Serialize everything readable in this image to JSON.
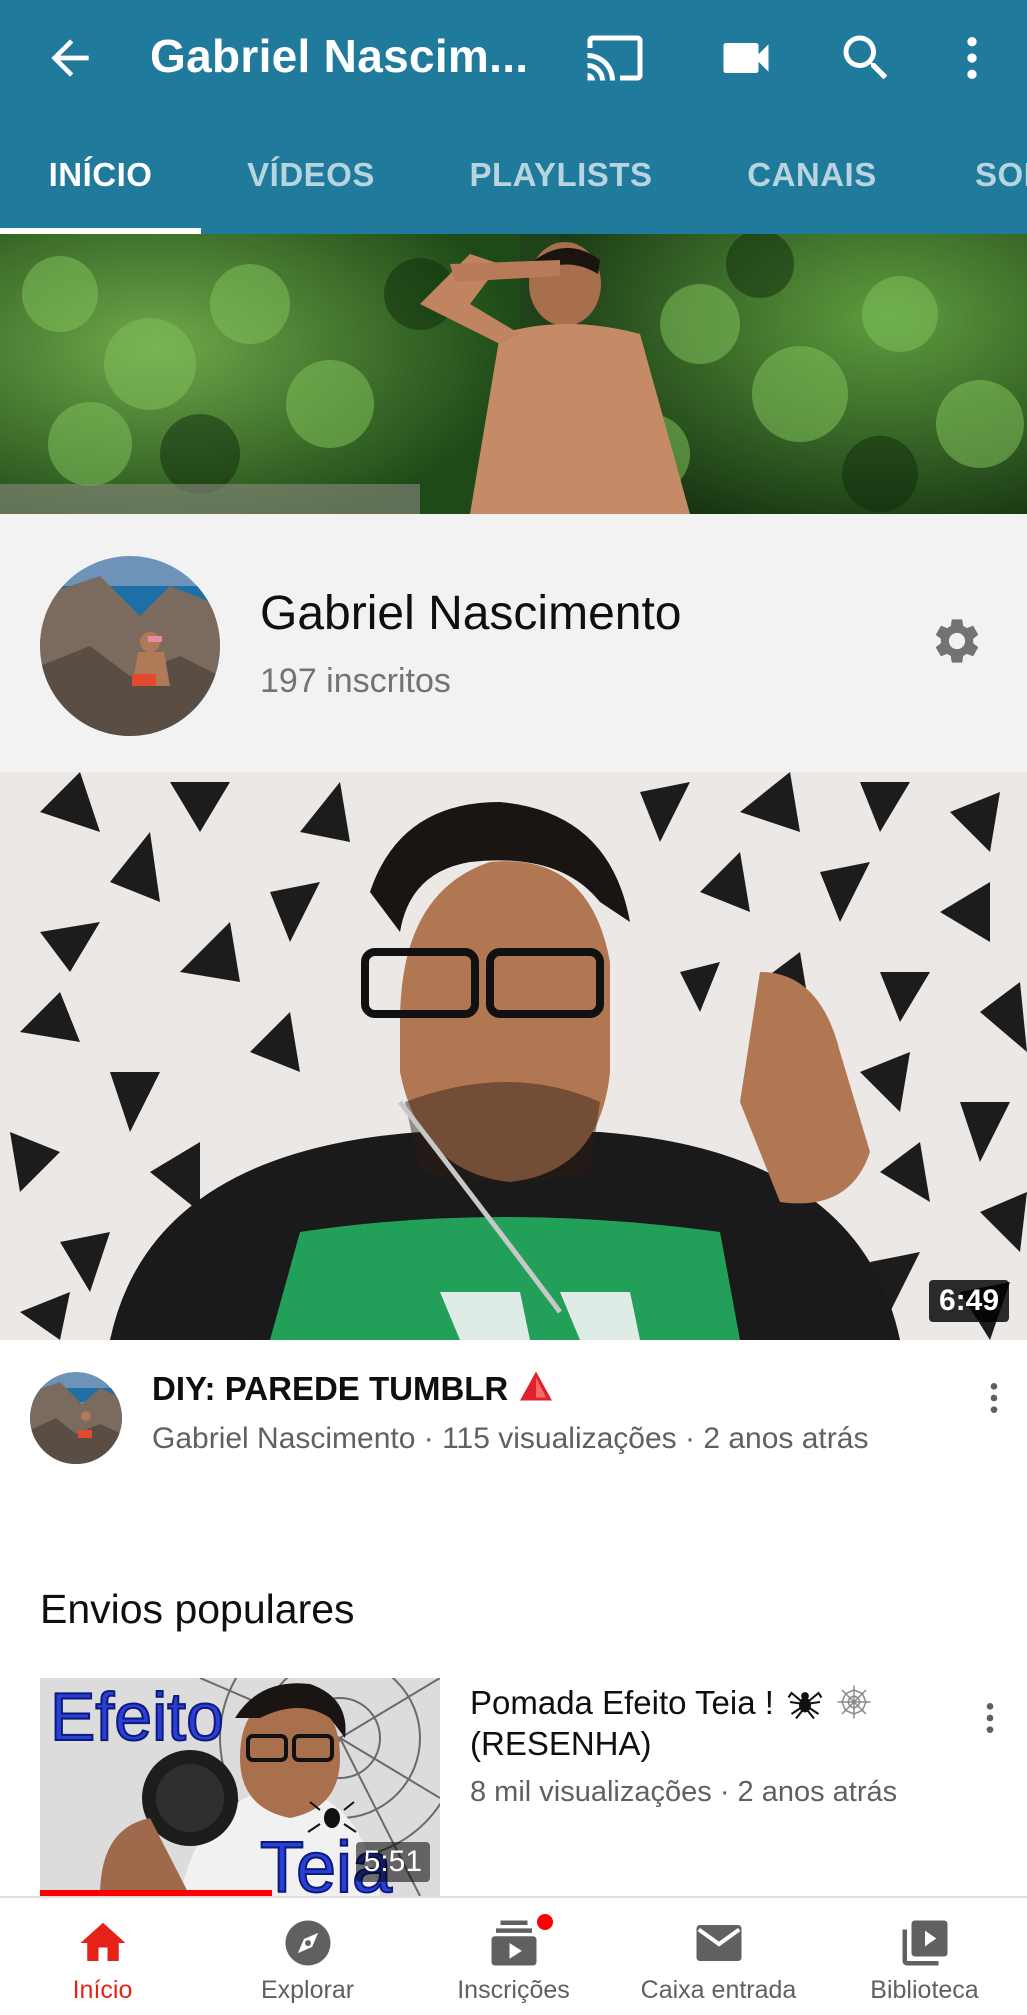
{
  "app_bar": {
    "title": "Gabriel Nascim...",
    "icons": [
      "back-arrow-icon",
      "cast-icon",
      "video-camera-icon",
      "search-icon",
      "more-vert-icon"
    ],
    "background": "#1f7a9c"
  },
  "tabs": [
    {
      "label": "INÍCIO",
      "active": true
    },
    {
      "label": "VÍDEOS",
      "active": false
    },
    {
      "label": "PLAYLISTS",
      "active": false
    },
    {
      "label": "CANAIS",
      "active": false
    },
    {
      "label": "SOBRE",
      "active": false
    }
  ],
  "channel": {
    "name": "Gabriel Nascimento",
    "subscribers": "197 inscritos",
    "settings_icon": "gear-icon"
  },
  "featured_video": {
    "duration": "6:49",
    "title": "DIY: PAREDE TUMBLR",
    "title_icon": "red-triangle-icon",
    "meta": "Gabriel Nascimento · 115 visualizações · 2 anos atrás"
  },
  "popular": {
    "section_title": "Envios populares",
    "items": [
      {
        "title": "Pomada Efeito Teia !",
        "title_suffix": "(RESENHA)",
        "title_icons": [
          "spider-icon",
          "spider-web-icon"
        ],
        "meta": "8 mil visualizações · 2 anos atrás",
        "duration": "5:51",
        "thumb_text_top": "Efeito",
        "thumb_text_bottom": "Teia",
        "watch_progress": 0.58
      }
    ]
  },
  "bottom_nav": [
    {
      "label": "Início",
      "icon": "home-icon",
      "active": true
    },
    {
      "label": "Explorar",
      "icon": "compass-icon",
      "active": false
    },
    {
      "label": "Inscrições",
      "icon": "subscriptions-icon",
      "active": false,
      "badge": true
    },
    {
      "label": "Caixa entrada",
      "icon": "mail-icon",
      "active": false
    },
    {
      "label": "Biblioteca",
      "icon": "library-icon",
      "active": false
    }
  ],
  "colors": {
    "accent_red": "#e62117",
    "header_blue": "#1f7a9c",
    "secondary_text": "#606060"
  }
}
